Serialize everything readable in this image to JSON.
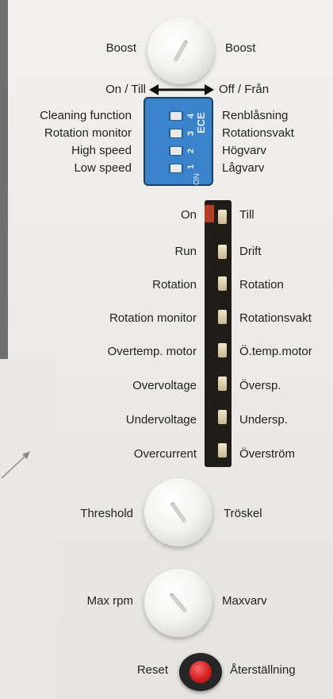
{
  "boost": {
    "left": "Boost",
    "right": "Boost"
  },
  "direction": {
    "left": "On / Till",
    "right": "Off / Från"
  },
  "dip_labels_left": [
    "Cleaning function",
    "Rotation monitor",
    "High speed",
    "Low speed"
  ],
  "dip_labels_right": [
    "Renblåsning",
    "Rotationsvakt",
    "Högvarv",
    "Lågvarv"
  ],
  "dip_switch": {
    "numbers": [
      "4",
      "3",
      "2",
      "1"
    ],
    "brand": "ECE",
    "on_mark": "ON"
  },
  "led_labels_left": [
    "On",
    "Run",
    "Rotation",
    "Rotation monitor",
    "Overtemp. motor",
    "Overvoltage",
    "Undervoltage",
    "Overcurrent"
  ],
  "led_labels_right": [
    "Till",
    "Drift",
    "Rotation",
    "Rotationsvakt",
    "Ö.temp.motor",
    "Översp.",
    "Undersp.",
    "Överström"
  ],
  "threshold": {
    "left": "Threshold",
    "right": "Tröskel"
  },
  "max_rpm": {
    "left": "Max rpm",
    "right": "Maxvarv"
  },
  "reset": {
    "left": "Reset",
    "right": "Återställning"
  },
  "colors": {
    "panel": "#efeeea",
    "dip_blue": "#3a82c9",
    "reset_red": "#d81f1f",
    "led_strip": "#201d18"
  }
}
